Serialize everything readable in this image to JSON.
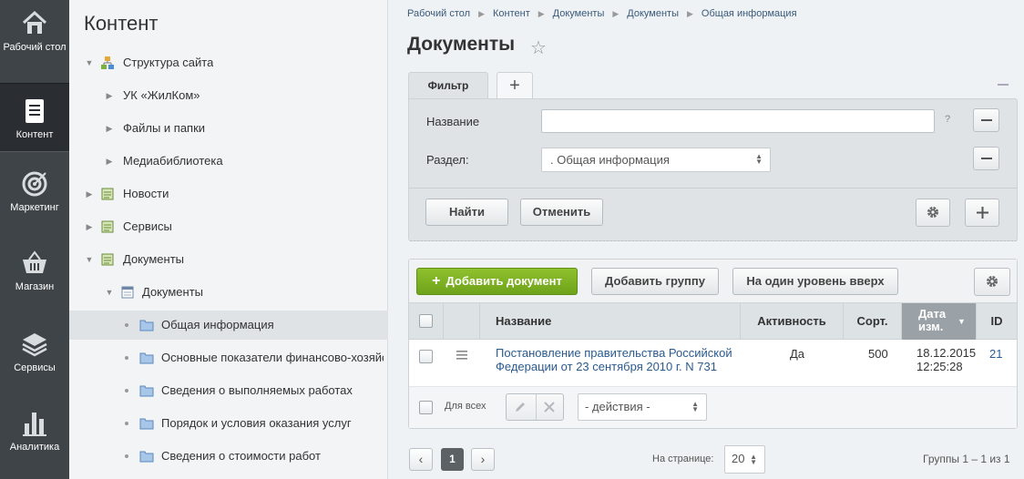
{
  "leftmenu": {
    "items": [
      {
        "label": "Рабочий стол",
        "icon": "home-icon"
      },
      {
        "label": "Контент",
        "icon": "document-icon"
      },
      {
        "label": "Маркетинг",
        "icon": "target-icon"
      },
      {
        "label": "Магазин",
        "icon": "basket-icon"
      },
      {
        "label": "Сервисы",
        "icon": "layers-icon"
      },
      {
        "label": "Аналитика",
        "icon": "bar-chart-icon"
      }
    ]
  },
  "tree": {
    "title": "Контент",
    "items": [
      {
        "label": "Структура сайта"
      },
      {
        "label": "УК «ЖилКом»"
      },
      {
        "label": "Файлы и папки"
      },
      {
        "label": "Медиабиблиотека"
      },
      {
        "label": "Новости"
      },
      {
        "label": "Сервисы"
      },
      {
        "label": "Документы"
      },
      {
        "label": "Документы"
      },
      {
        "label": "Общая информация"
      },
      {
        "label": "Основные показатели финансово-хозяйс"
      },
      {
        "label": "Сведения о выполняемых работах"
      },
      {
        "label": "Порядок и условия оказания услуг"
      },
      {
        "label": "Сведения о стоимости работ"
      }
    ]
  },
  "breadcrumb": [
    "Рабочий стол",
    "Контент",
    "Документы",
    "Документы",
    "Общая информация"
  ],
  "page_title": "Документы",
  "filter": {
    "tab_label": "Фильтр",
    "add_tab": "+",
    "name_label": "Название",
    "name_value": "",
    "help": "?",
    "section_label": "Раздел:",
    "section_value": ". Общая информация",
    "find_label": "Найти",
    "cancel_label": "Отменить"
  },
  "toolbar": {
    "add_document": "Добавить документ",
    "add_group": "Добавить группу",
    "level_up": "На один уровень вверх"
  },
  "grid": {
    "columns": {
      "name": "Название",
      "active": "Активность",
      "sort": "Сорт.",
      "date": "Дата изм.",
      "id": "ID"
    },
    "rows": [
      {
        "name_line1": "Постановление правительства Российской",
        "name_line2": "Федерации от 23 сентября 2010 г. N 731",
        "active": "Да",
        "sort": "500",
        "date_line1": "18.12.2015",
        "date_line2": "12:25:28",
        "id": "21"
      }
    ],
    "footer": {
      "for_all": "Для всех",
      "actions": "- действия -"
    }
  },
  "pager": {
    "current_page": "1",
    "per_page_label": "На странице:",
    "per_page_value": "20",
    "summary": "Группы 1 – 1 из 1"
  }
}
